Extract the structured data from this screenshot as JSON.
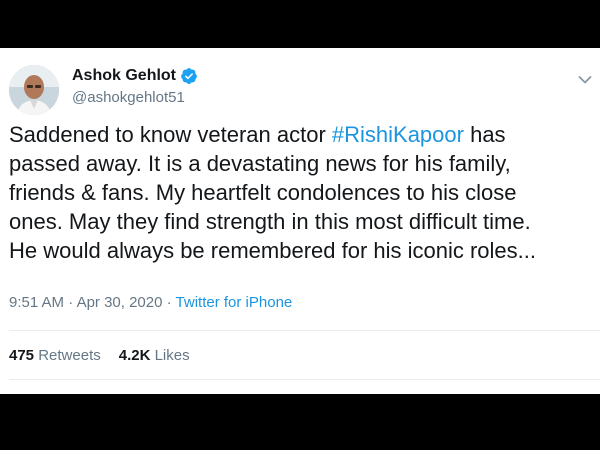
{
  "tweet": {
    "author": {
      "name": "Ashok Gehlot",
      "handle": "@ashokgehlot51",
      "verified_icon": "verified-badge-icon",
      "avatar_icon": "profile-photo"
    },
    "text": {
      "line1_before": "Saddened to know veteran actor ",
      "hashtag": "#RishiKapoor",
      "line1_after": " has",
      "line2": "passed away. It is a devastating news for his family,",
      "line3": "friends & fans. My heartfelt condolences to his close",
      "line4": "ones. May they find strength in this most difficult time.",
      "line5": "He would always be remembered for his iconic roles..."
    },
    "time": "9:51 AM",
    "separator1": " · ",
    "date": "Apr 30, 2020",
    "separator2": " · ",
    "source": "Twitter for iPhone",
    "stats": {
      "retweets_count": "475",
      "retweets_label": "Retweets",
      "likes_count": "4.2K",
      "likes_label": "Likes"
    },
    "menu_icon": "chevron-down-icon"
  },
  "colors": {
    "link": "#1b95e0",
    "text": "#14171a",
    "muted": "#657786",
    "verified": "#1da1f2",
    "frame": "#000000"
  }
}
